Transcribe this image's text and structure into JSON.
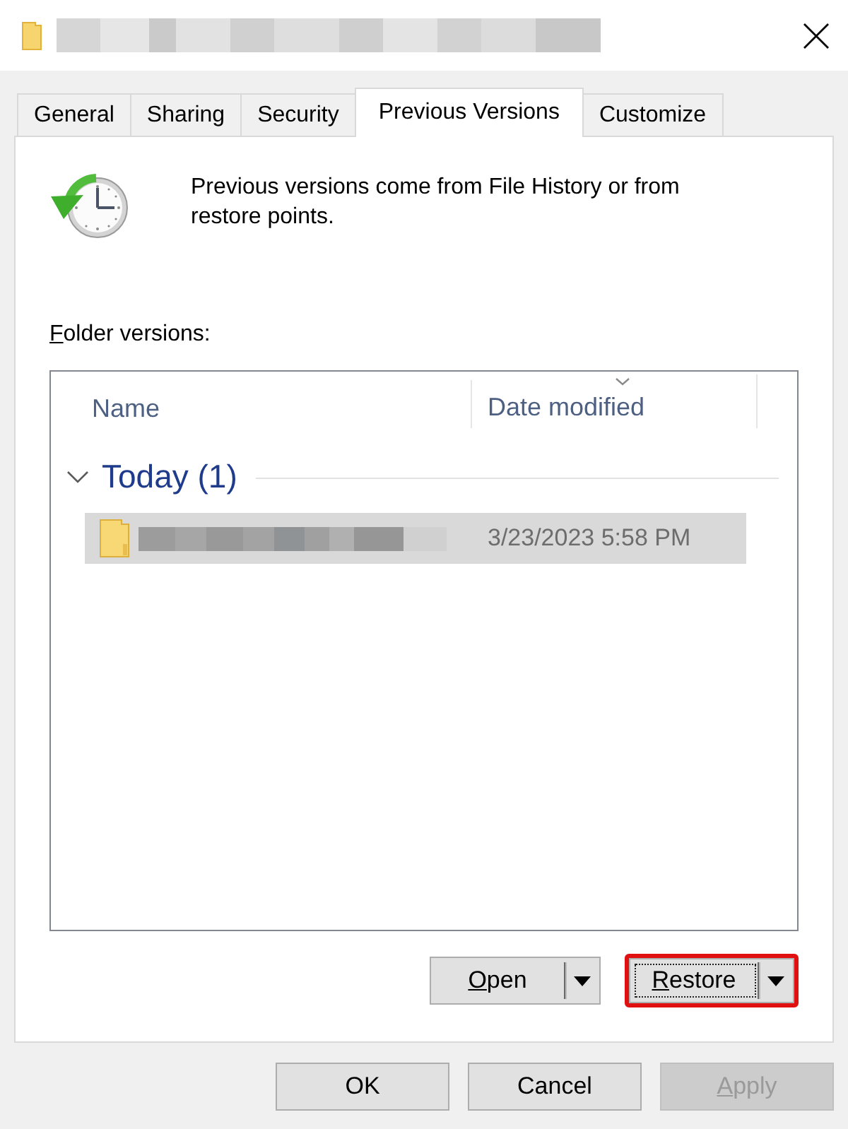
{
  "tabs": [
    {
      "label": "General",
      "selected": false
    },
    {
      "label": "Sharing",
      "selected": false
    },
    {
      "label": "Security",
      "selected": false
    },
    {
      "label": "Previous Versions",
      "selected": true
    },
    {
      "label": "Customize",
      "selected": false
    }
  ],
  "intro": {
    "text": "Previous versions come from File History or from restore points."
  },
  "versions": {
    "label": "Folder versions:",
    "mnemonic": true,
    "columns": [
      {
        "label": "Name",
        "sorted": false
      },
      {
        "label": "Date modified",
        "sorted": true
      }
    ],
    "groups": [
      {
        "label": "Today (1)",
        "expanded": true,
        "items": [
          {
            "date_modified": "3/23/2023 5:58 PM",
            "selected": true
          }
        ]
      }
    ]
  },
  "action_buttons": [
    {
      "label": "Open",
      "mnemonic": true,
      "highlighted": false,
      "focused": false
    },
    {
      "label": "Restore",
      "mnemonic": true,
      "highlighted": true,
      "focused": true
    }
  ],
  "dialog_buttons": [
    {
      "label": "OK",
      "mnemonic": false,
      "disabled": false
    },
    {
      "label": "Cancel",
      "mnemonic": false,
      "disabled": false
    },
    {
      "label": "Apply",
      "mnemonic": true,
      "disabled": true
    }
  ]
}
